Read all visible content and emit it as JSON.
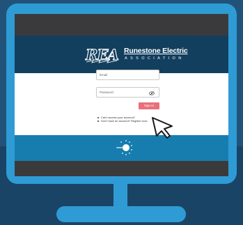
{
  "brand": {
    "name": "Runestone Electric",
    "subtitle": "ASSOCIATION",
    "logo_letters": "REA"
  },
  "login": {
    "email_placeholder": "Email",
    "password_placeholder": "Password",
    "signin_label": "Sign In",
    "help_links": [
      "Can't access your account?",
      "Don't have an account? Register now"
    ]
  },
  "footer": {
    "logo_text": "smarthub"
  },
  "colors": {
    "monitor": "#2f9bd4",
    "brand_band": "#123f5e",
    "footer_band": "#177dae",
    "signin_button": "#e8707a"
  },
  "icons": [
    "rea-logo-icon",
    "eye-icon",
    "smarthub-logo-icon",
    "mouse-cursor-icon"
  ]
}
